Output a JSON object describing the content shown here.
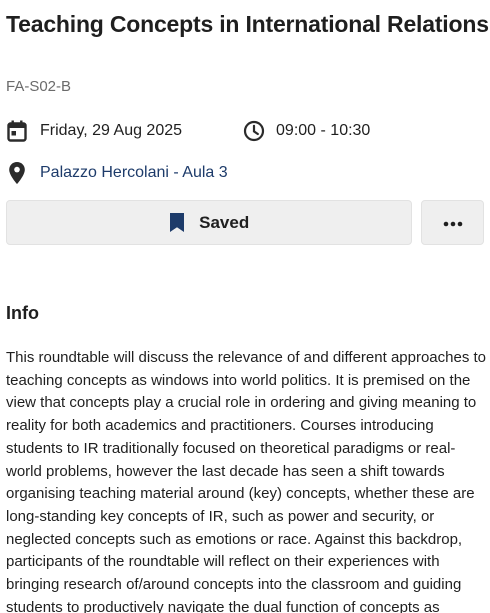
{
  "session": {
    "title": "Teaching Concepts in International Relations",
    "code": "FA-S02-B",
    "date": "Friday, 29 Aug 2025",
    "time": "09:00 - 10:30",
    "location": "Palazzo Hercolani - Aula 3"
  },
  "actions": {
    "saved_label": "Saved",
    "more_label": "•••"
  },
  "icons": {
    "date": "calendar-icon",
    "time": "clock-icon",
    "location": "map-pin-icon",
    "saved": "bookmark-icon",
    "more": "more-horizontal-icon"
  },
  "info": {
    "heading": "Info",
    "description": "This roundtable will discuss the relevance of and different approaches to teaching concepts as windows into world politics. It is premised on the view that concepts play a crucial role in ordering and giving meaning to reality for both academics and practitioners. Courses introducing students to IR traditionally focused on theoretical paradigms or real-world problems, however the last decade has seen a shift towards organising teaching material around (key) concepts, whether these are long-standing key concepts of IR, such as power and security, or neglected concepts such as emotions or race. Against this backdrop, participants of the roundtable will reflect on their experiences with bringing research of/around concepts into the classroom and guiding students to productively navigate the dual function of concepts as"
  },
  "colors": {
    "link": "#1d3b6a",
    "button_bg": "#efefef",
    "muted_text": "#6b6b6b"
  }
}
